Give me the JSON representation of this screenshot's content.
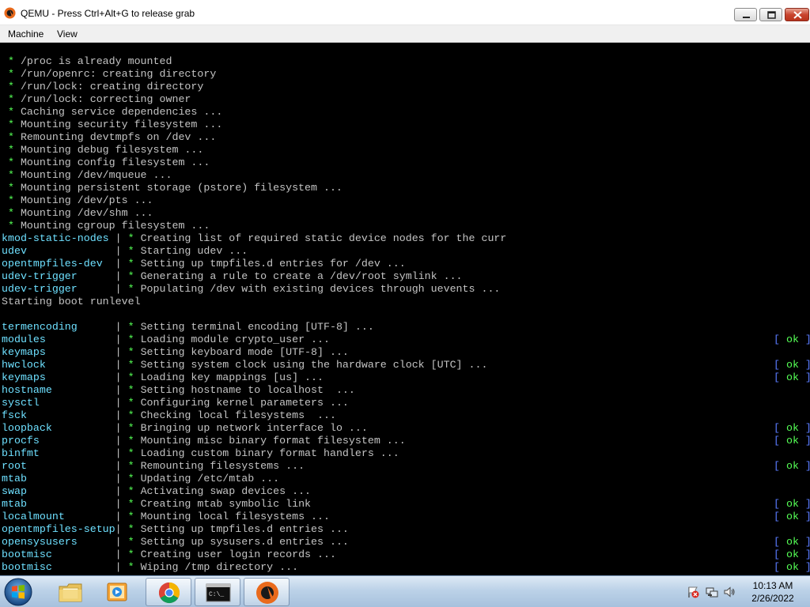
{
  "window": {
    "title": "QEMU - Press Ctrl+Alt+G to release grab",
    "icon": "qemu-icon",
    "controls": [
      "minimize",
      "maximize",
      "close"
    ]
  },
  "menubar": {
    "items": [
      {
        "label": "Machine"
      },
      {
        "label": "View"
      }
    ]
  },
  "console": {
    "colors": {
      "star": "#55ff55",
      "service": "#6ee0ff",
      "bracket": "#5a7bff",
      "text": "#c4c4c4"
    },
    "lines": [
      {
        "type": "star",
        "text": "/proc is already mounted"
      },
      {
        "type": "star",
        "text": "/run/openrc: creating directory"
      },
      {
        "type": "star",
        "text": "/run/lock: creating directory"
      },
      {
        "type": "star",
        "text": "/run/lock: correcting owner"
      },
      {
        "type": "star",
        "text": "Caching service dependencies ..."
      },
      {
        "type": "star",
        "text": "Mounting security filesystem ..."
      },
      {
        "type": "star",
        "text": "Remounting devtmpfs on /dev ..."
      },
      {
        "type": "star",
        "text": "Mounting debug filesystem ..."
      },
      {
        "type": "star",
        "text": "Mounting config filesystem ..."
      },
      {
        "type": "star",
        "text": "Mounting /dev/mqueue ..."
      },
      {
        "type": "star",
        "text": "Mounting persistent storage (pstore) filesystem ..."
      },
      {
        "type": "star",
        "text": "Mounting /dev/pts ..."
      },
      {
        "type": "star",
        "text": "Mounting /dev/shm ..."
      },
      {
        "type": "star",
        "text": "Mounting cgroup filesystem ..."
      },
      {
        "type": "svc",
        "service": "kmod-static-nodes",
        "text": "Creating list of required static device nodes for the curr",
        "ok": false
      },
      {
        "type": "svc",
        "service": "udev",
        "text": "Starting udev ...",
        "ok": false
      },
      {
        "type": "svc",
        "service": "opentmpfiles-dev",
        "text": "Setting up tmpfiles.d entries for /dev ...",
        "ok": false
      },
      {
        "type": "svc",
        "service": "udev-trigger",
        "text": "Generating a rule to create a /dev/root symlink ...",
        "ok": false
      },
      {
        "type": "svc",
        "service": "udev-trigger",
        "text": "Populating /dev with existing devices through uevents ...",
        "ok": false
      },
      {
        "type": "plain",
        "text": "Starting boot runlevel"
      },
      {
        "type": "blank",
        "text": ""
      },
      {
        "type": "svc",
        "service": "termencoding",
        "text": "Setting terminal encoding [UTF-8] ...",
        "ok": false
      },
      {
        "type": "svc",
        "service": "modules",
        "text": "Loading module crypto_user ...",
        "ok": true
      },
      {
        "type": "svc",
        "service": "keymaps",
        "text": "Setting keyboard mode [UTF-8] ...",
        "ok": false
      },
      {
        "type": "svc",
        "service": "hwclock",
        "text": "Setting system clock using the hardware clock [UTC] ...",
        "ok": true
      },
      {
        "type": "svc",
        "service": "keymaps",
        "text": "Loading key mappings [us] ...",
        "ok": true
      },
      {
        "type": "svc",
        "service": "hostname",
        "text": "Setting hostname to localhost  ...",
        "ok": false
      },
      {
        "type": "svc",
        "service": "sysctl",
        "text": "Configuring kernel parameters ...",
        "ok": false
      },
      {
        "type": "svc",
        "service": "fsck",
        "text": "Checking local filesystems  ...",
        "ok": false
      },
      {
        "type": "svc",
        "service": "loopback",
        "text": "Bringing up network interface lo ...",
        "ok": true
      },
      {
        "type": "svc",
        "service": "procfs",
        "text": "Mounting misc binary format filesystem ...",
        "ok": true
      },
      {
        "type": "svc",
        "service": "binfmt",
        "text": "Loading custom binary format handlers ...",
        "ok": false
      },
      {
        "type": "svc",
        "service": "root",
        "text": "Remounting filesystems ...",
        "ok": true
      },
      {
        "type": "svc",
        "service": "mtab",
        "text": "Updating /etc/mtab ...",
        "ok": false
      },
      {
        "type": "svc",
        "service": "swap",
        "text": "Activating swap devices ...",
        "ok": false
      },
      {
        "type": "svc",
        "service": "mtab",
        "text": "Creating mtab symbolic link",
        "ok": true
      },
      {
        "type": "svc",
        "service": "localmount",
        "text": "Mounting local filesystems ...",
        "ok": true
      },
      {
        "type": "svc",
        "service": "opentmpfiles-setup",
        "text": "Setting up tmpfiles.d entries ...",
        "ok": false
      },
      {
        "type": "svc",
        "service": "opensysusers",
        "text": "Setting up sysusers.d entries ...",
        "ok": true
      },
      {
        "type": "svc",
        "service": "bootmisc",
        "text": "Creating user login records ...",
        "ok": true
      },
      {
        "type": "svc",
        "service": "bootmisc",
        "text": "Wiping /tmp directory ...",
        "ok": true
      }
    ],
    "ok_label": "ok",
    "star_glyph": "*",
    "separator": "|"
  },
  "taskbar": {
    "start": "windows-start-orb-icon",
    "apps": [
      {
        "name": "file-explorer-icon",
        "active": false
      },
      {
        "name": "media-player-icon",
        "active": false
      },
      {
        "name": "chrome-icon",
        "active": true
      },
      {
        "name": "command-prompt-icon",
        "active": true
      },
      {
        "name": "qemu-icon",
        "active": true
      }
    ],
    "tray": [
      "action-center-flag-icon",
      "network-icon",
      "volume-icon"
    ],
    "clock": {
      "time": "10:13 AM",
      "date": "2/26/2022"
    }
  }
}
